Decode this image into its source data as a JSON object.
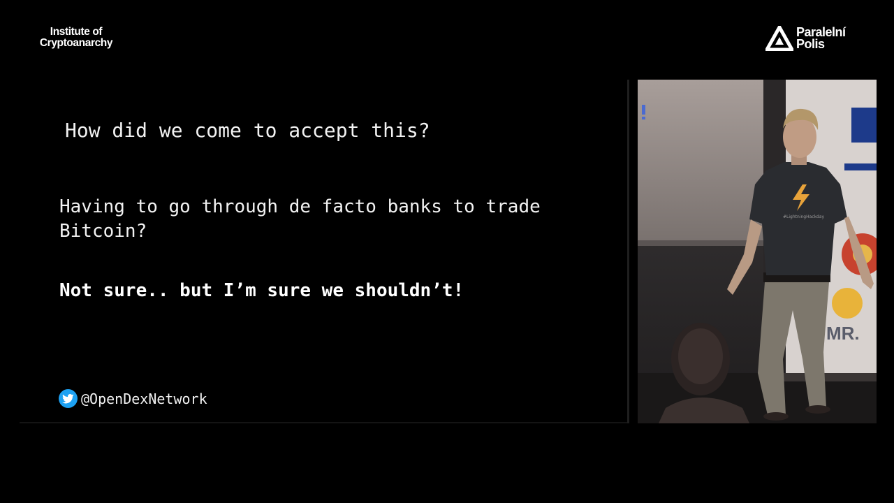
{
  "branding": {
    "left_logo_line1": "Institute of",
    "left_logo_line2": "Cryptoanarchy",
    "right_logo_line1": "Paralelní",
    "right_logo_line2": "Polis"
  },
  "slide": {
    "title": "How did we come to accept this?",
    "body": "Having to go through de facto banks to trade Bitcoin?",
    "answer": "Not sure.. but I’m sure we shouldn’t!",
    "twitter_handle": "@OpenDexNetwork"
  },
  "speaker_video": {
    "shirt_text": "#LightningHackday",
    "backdrop_text": "MR."
  },
  "colors": {
    "background": "#000000",
    "twitter_blue": "#1da1f2",
    "text": "#f2f2f2"
  },
  "icons": [
    "twitter-bird-icon",
    "paralelni-polis-triangle-icon"
  ]
}
